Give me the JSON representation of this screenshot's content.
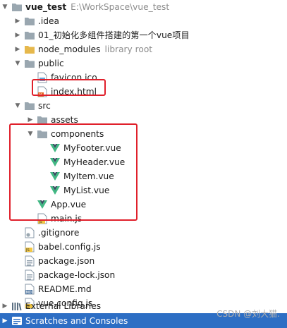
{
  "project": {
    "name": "vue_test",
    "path": "E:\\WorkSpace\\vue_test"
  },
  "items": {
    "idea": ".idea",
    "init_doc": "01_初始化多组件搭建的第一个vue项目",
    "node_modules": "node_modules",
    "node_modules_hint": "library root",
    "public": "public",
    "favicon": "favicon.ico",
    "index_html": "index.html",
    "src": "src",
    "assets": "assets",
    "components": "components",
    "my_footer": "MyFooter.vue",
    "my_header": "MyHeader.vue",
    "my_item": "MyItem.vue",
    "my_list": "MyList.vue",
    "app_vue": "App.vue",
    "main_js": "main.js",
    "gitignore": ".gitignore",
    "babel_config": "babel.config.js",
    "package_json": "package.json",
    "package_lock": "package-lock.json",
    "readme": "README.md",
    "vue_config": "vue.config.js",
    "external_libraries": "External Libraries",
    "scratches": "Scratches and Consoles"
  },
  "watermark": "CSDN @刘大猫.",
  "colors": {
    "selection": "#2d6ec4",
    "highlight_box": "#e0202b",
    "folder": "#9aa7b0",
    "vue_green": "#41b883",
    "js_yellow": "#f4c842"
  }
}
